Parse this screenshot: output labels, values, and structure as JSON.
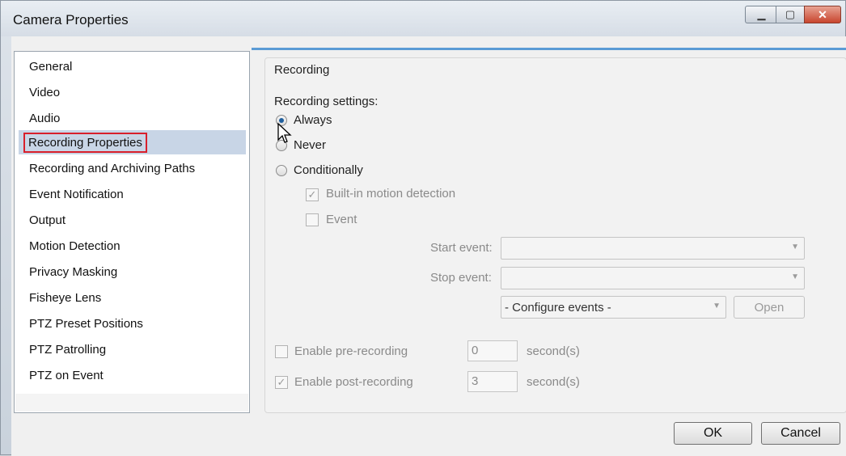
{
  "window": {
    "title": "Camera Properties"
  },
  "title_buttons": {
    "minimize": "▁",
    "maximize": "▢",
    "close": "✕"
  },
  "nav": {
    "items": [
      {
        "label": "General"
      },
      {
        "label": "Video"
      },
      {
        "label": "Audio"
      },
      {
        "label": "Recording Properties",
        "selected": true
      },
      {
        "label": "Recording and Archiving Paths"
      },
      {
        "label": "Event Notification"
      },
      {
        "label": "Output"
      },
      {
        "label": "Motion Detection"
      },
      {
        "label": "Privacy Masking"
      },
      {
        "label": "Fisheye Lens"
      },
      {
        "label": "PTZ Preset Positions"
      },
      {
        "label": "PTZ Patrolling"
      },
      {
        "label": "PTZ on Event"
      }
    ]
  },
  "recording": {
    "group_title": "Recording",
    "settings_label": "Recording settings:",
    "always": "Always",
    "never": "Never",
    "conditionally": "Conditionally",
    "builtin_motion": "Built-in motion detection",
    "event": "Event",
    "start_event_label": "Start event:",
    "start_event_value": "",
    "stop_event_label": "Stop event:",
    "stop_event_value": "",
    "configure_events_value": "- Configure events -",
    "open_button": "Open",
    "pre_recording_label": "Enable pre-recording",
    "pre_recording_value": "0",
    "post_recording_label": "Enable post-recording",
    "post_recording_value": "3",
    "seconds_unit": "second(s)",
    "selected_option": "Always",
    "builtin_motion_checked": true,
    "event_checked": false,
    "pre_recording_checked": false,
    "post_recording_checked": true
  },
  "footer": {
    "ok": "OK",
    "cancel": "Cancel"
  },
  "colors": {
    "selection": "#c8d5e6",
    "highlight_border": "#d81f2b",
    "accent": "#5b9bd5"
  }
}
